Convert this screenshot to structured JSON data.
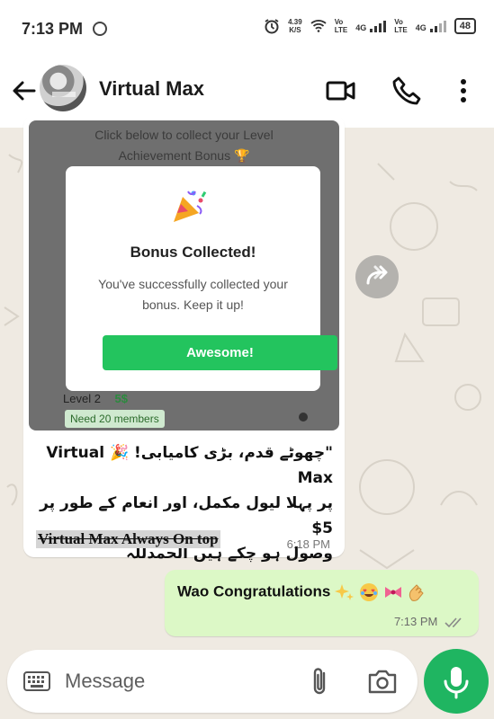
{
  "status_bar": {
    "time": "7:13 PM",
    "net_speed_value": "4.39",
    "net_speed_unit": "K/S",
    "sim1_label": "Vo\nLTE",
    "sim1_net": "4G",
    "sim2_label": "Vo\nLTE",
    "sim2_net": "4G",
    "battery": "48"
  },
  "header": {
    "contact_name": "Virtual Max"
  },
  "chat": {
    "incoming": {
      "image": {
        "top_text_line1": "Click below to collect your Level",
        "top_text_line2": "Achievement Bonus 🏆",
        "modal_title": "Bonus Collected!",
        "modal_text": "You've successfully collected your bonus. Keep it up!",
        "modal_button": "Awesome!",
        "level_label": "Level 2",
        "level_amount": "5$",
        "level_badge": "Need 20 members"
      },
      "urdu_line1": "\"چھوٹے قدم، بڑی کامیابی! 🎉 Virtual Max",
      "urdu_line2": "پر پہلا لیول مکمل، اور انعام کے طور پر 5$",
      "urdu_line3": "وصول ہو چکے ہیں الحمدللہ",
      "english_text": "Virtual Max Always On top",
      "time": "6:18 PM"
    },
    "outgoing": {
      "text": "Wao Congratulations",
      "time": "7:13 PM"
    }
  },
  "composer": {
    "placeholder": "Message"
  },
  "colors": {
    "accent_green": "#1fb561",
    "outgoing_bubble": "#dcf8c6",
    "modal_button": "#23c45e"
  }
}
